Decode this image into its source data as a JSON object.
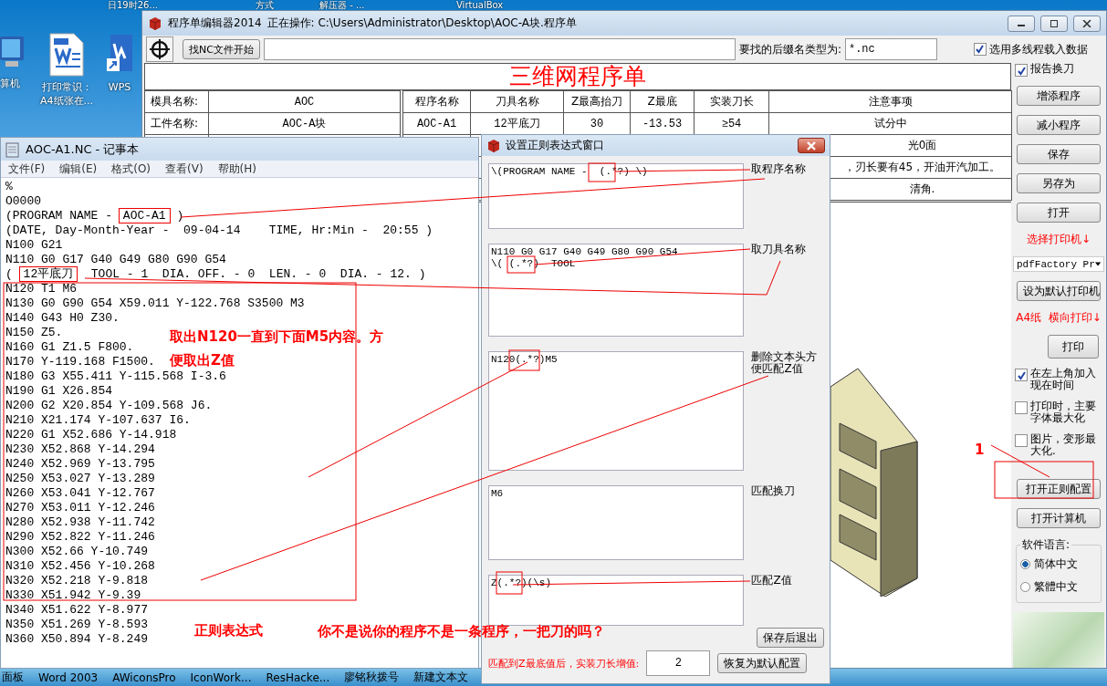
{
  "desktop": {
    "top_labels": [
      "日19时26...",
      "方式",
      "解压器 - ...",
      "VirtualBox"
    ],
    "icons": [
      {
        "kind": "computer",
        "label": "算机"
      },
      {
        "kind": "document",
        "label": "打印常识：A4纸张在..."
      },
      {
        "kind": "shortcut",
        "label": "WPS"
      }
    ]
  },
  "main_window": {
    "title": "程序单编辑器2014",
    "status": "正在操作: C:\\Users\\Administrator\\Desktop\\AOC-A块.程序单",
    "find_button": "找NC文件开始",
    "suffix_label": "要找的后缀名类型为:",
    "suffix_field": {
      "value": "*.nc"
    },
    "multithread": {
      "label": "选用多线程载入数据",
      "checked": true
    },
    "sheet_title": "三维网程序单",
    "info": [
      {
        "label": "模具名称:",
        "value": "AOC"
      },
      {
        "label": "工件名称:",
        "value": "AOC-A块"
      }
    ],
    "table": {
      "columns": [
        "程序名称",
        "刀具名称",
        "Z最高抬刀",
        "Z最底",
        "实装刀长",
        "注意事项"
      ],
      "rows": [
        [
          "AOC-A1",
          "12平底刀",
          "30",
          "-13.53",
          "≥54",
          "试分中"
        ]
      ],
      "partly_covered_notes": [
        "光0面",
        "，刃长要有45，开油开汽加工。",
        "清角."
      ]
    },
    "side_panel": [
      {
        "kind": "checkbox",
        "label": "报告换刀",
        "checked": true
      },
      {
        "kind": "button",
        "label": "增添程序"
      },
      {
        "kind": "button",
        "label": "减小程序"
      },
      {
        "kind": "button",
        "label": "保存"
      },
      {
        "kind": "button",
        "label": "另存为"
      },
      {
        "kind": "button",
        "label": "打开"
      },
      {
        "kind": "note",
        "label": "选择打印机↓"
      },
      {
        "kind": "select",
        "value": "pdfFactory Pr"
      },
      {
        "kind": "button",
        "label": "设为默认打印机"
      },
      {
        "kind": "note",
        "label": "A4纸  横向打印↓"
      },
      {
        "kind": "short_button",
        "label": "打印"
      },
      {
        "kind": "checkbox",
        "label": "在左上角加入现在时间",
        "checked": true
      },
      {
        "kind": "checkbox",
        "label": "打印时，主要字体最大化",
        "checked": false
      },
      {
        "kind": "checkbox",
        "label": "图片，变形最大化.",
        "checked": false
      },
      {
        "kind": "button",
        "label": "打开正则配置"
      },
      {
        "kind": "button",
        "label": "打开计算机"
      },
      {
        "kind": "radio_group",
        "label": "软件语言:",
        "options": [
          {
            "label": "简体中文",
            "selected": true
          },
          {
            "label": "繁體中文",
            "selected": false
          }
        ]
      }
    ]
  },
  "notepad": {
    "title": "AOC-A1.NC - 记事本",
    "menu": [
      "文件(F)",
      "编辑(E)",
      "格式(O)",
      "查看(V)",
      "帮助(H)"
    ],
    "lines": [
      "%",
      "O0000",
      {
        "before": "(PROGRAM NAME - ",
        "framed": "AOC-A1",
        "after": " )"
      },
      "(DATE, Day-Month-Year -  09-04-14    TIME, Hr:Min -  20:55 )",
      "N100 G21",
      "N110 G0 G17 G40 G49 G80 G90 G54",
      {
        "before": "( ",
        "framed": "12平底刀",
        "after": "  TOOL - 1  DIA. OFF. - 0  LEN. - 0  DIA. - 12. )"
      },
      "N120 T1 M6",
      "N130 G0 G90 G54 X59.011 Y-122.768 S3500 M3",
      "N140 G43 H0 Z30.",
      "N150 Z5.",
      "N160 G1 Z1.5 F800.",
      "N170 Y-119.168 F1500.",
      "N180 G3 X55.411 Y-115.568 I-3.6",
      "N190 G1 X26.854",
      "N200 G2 X20.854 Y-109.568 J6.",
      "N210 X21.174 Y-107.637 I6.",
      "N220 G1 X52.686 Y-14.918",
      "N230 X52.868 Y-14.294",
      "N240 X52.969 Y-13.795",
      "N250 X53.027 Y-13.289",
      "N260 X53.041 Y-12.767",
      "N270 X53.011 Y-12.246",
      "N280 X52.938 Y-11.742",
      "N290 X52.822 Y-11.246",
      "N300 X52.66 Y-10.749",
      "N310 X52.456 Y-10.268",
      "N320 X52.218 Y-9.818",
      "N330 X51.942 Y-9.39",
      "N340 X51.622 Y-8.977",
      "N350 X51.269 Y-8.593",
      "N360 X50.894 Y-8.249"
    ]
  },
  "regex_dialog": {
    "title": "设置正则表达式窗口",
    "patterns": [
      {
        "value": "\\(PROGRAM NAME -  (.*?) \\)",
        "label": "取程序名称"
      },
      {
        "value": "N110 G0 G17 G40 G49 G80 G90 G54\n\\( (.*?)  TOOL",
        "label": "取刀具名称"
      },
      {
        "value": "N120(.*?)M5",
        "label": "删除文本头方便匹配Z值"
      },
      {
        "value": "M6",
        "label": "匹配换刀"
      },
      {
        "value": "Z(.*?)(\\s)",
        "label": "匹配Z值"
      }
    ],
    "save_button": "保存后退出",
    "increment_label": "匹配到Z最底值后，实装刀长增值:",
    "increment_field": {
      "value": "2"
    },
    "reset_button": "恢复为默认配置"
  },
  "annotations": [
    "取出N120一直到下面M5内容。方便取出Z值",
    "正则表达式",
    "你不是说你的程序不是一条程序，一把刀的吗？",
    "1"
  ],
  "taskbar": [
    "面板",
    "Word 2003",
    "AWiconsPro",
    "IconWork...",
    "ResHacke...",
    "廖铭秋拨号",
    "新建文本文"
  ]
}
